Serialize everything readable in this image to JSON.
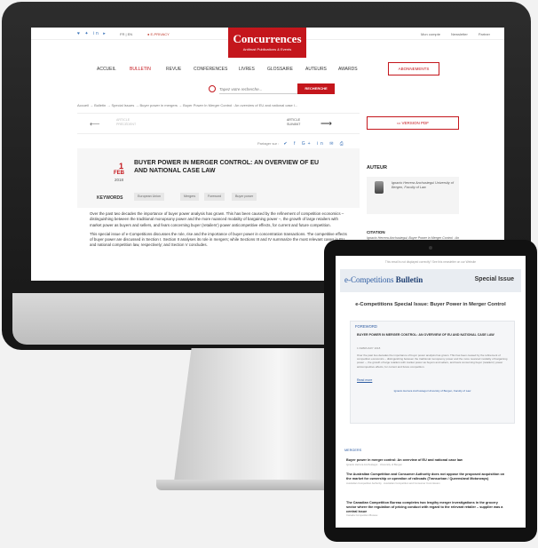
{
  "desktop": {
    "social_icons": "♥ ✦ in ▸",
    "lang": "FR | EN",
    "rss": "● E-PRIVACY",
    "logo": {
      "name": "Concurrences",
      "tagline": "Antitrust Publications & Events"
    },
    "top_links": [
      "Mon compte",
      "Newsletter",
      "Partner"
    ],
    "nav": [
      "ACCUEIL",
      "BULLETIN",
      "REVUE",
      "CONFÉRENCES",
      "LIVRES",
      "GLOSSAIRE",
      "AUTEURS",
      "AWARDS"
    ],
    "subscribe_label": "ABONNEMENTS",
    "search": {
      "placeholder": "Tapez votre recherche...",
      "button": "RECHERCHE"
    },
    "breadcrumb": "Accueil → Bulletin → Special Issues → Buyer power in mergers → Buyer Power In Merger Control : An overview of EU and national case l...",
    "pager": {
      "prev": "ARTICLE PRÉCÉDENT",
      "next": "ARTICLE SUIVANT"
    },
    "pdf_label": "VERSION PDF",
    "share_label": "Partager sur :",
    "share_icons": "✔ f G+ in ✉ ⎙",
    "article": {
      "day": "1",
      "month": "FEB",
      "year": "2018",
      "title": "BUYER POWER IN MERGER CONTROL: AN OVERVIEW OF EU AND NATIONAL CASE LAW",
      "keywords_label": "KEYWORDS",
      "keywords": [
        "European Union",
        "Mergers",
        "Foreword",
        "Buyer power"
      ],
      "paragraph1": "Over the past two decades the importance of buyer power analysis has grown. This has been caused by the refinement of competition economics – distinguishing between the traditional monopsony power and the more nuanced modality of bargaining power –, the growth of large retailers with market power as buyers and sellers, and fears concerning buyer (retailers’) power anticompetitive effects, for current and future competition.",
      "paragraph2": "This special issue of e-Competitions discusses the role, rise and the importance of buyer power in concentration transactions. The competitive effects of buyer power are discussed in Section I. Section II analyses its role in mergers; while Sections III and IV summarize the most relevant cases in EU and national competition law, respectively; and Section V concludes."
    },
    "sidebar": {
      "author_heading": "AUTEUR",
      "author_name": "Ignacio Herrera Anchustegui University of Bergen, Faculty of Law",
      "citation_heading": "CITATION",
      "citation": "Ignacio Herrera Anchustegui, Buyer Power in Merger Control : An overview of EU and national case law, 1er février 2018, Bulletin e-Competitions Buyer"
    }
  },
  "tablet": {
    "note": "This email is not displayed correctly? See this newsletter on our Website",
    "logo_prefix": "e-Competitions",
    "logo_suffix": "Bulletin",
    "special_issue": "Special Issue",
    "title": "e-Competitions Special Issue: Buyer Power in Merger Control",
    "foreword": {
      "heading": "FOREWORD",
      "title": "BUYER POWER IN MERGER CONTROL: AN OVERVIEW OF EU AND NATIONAL CASE LAW",
      "date": "1 FEBRUARY 2018",
      "body": "Over the past two decades the importance of buyer power analysis has grown. This has been caused by the refinement of competition economics – distinguishing between the traditional monopsony power and the more nuanced modality of bargaining power –, the growth of large retailers with market power as buyers and sellers, and fears concerning buyer (retailers’) power anticompetitive effects, for current and future competition.",
      "read_more": "Read more",
      "author": "Ignacio Herrera Anchustegui University of Bergen, Faculty of Law"
    },
    "mergers_heading": "MERGERS",
    "items": [
      {
        "title": "Buyer power in merger control: An overview of EU and national case law",
        "meta": "Ignacio Herrera Anchustegui · University of Bergen"
      },
      {
        "title": "The Australian Competition and Consumer Authority does not oppose the proposed acquisition on the market for ownership or operation of railroads (Transurban / Queensland Motorways)",
        "meta": "Australian Competition Authority · Australian Competition and Consumer Commission"
      },
      {
        "title": "The Canadian Competition Bureau completes two lengthy merger investigations in the grocery sector where the regulation of pricing conduct with regard to the relevant retailer – supplier was a central issue",
        "meta": "Canada Competition Bureau"
      }
    ]
  }
}
